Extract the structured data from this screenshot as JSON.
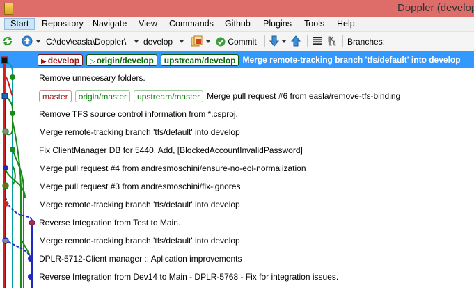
{
  "window": {
    "title": "Doppler (develop"
  },
  "menu": {
    "items": [
      {
        "label": "Start",
        "active": true
      },
      {
        "label": "Repository",
        "active": false
      },
      {
        "label": "Navigate",
        "active": false
      },
      {
        "label": "View",
        "active": false
      },
      {
        "label": "Commands",
        "active": false
      },
      {
        "label": "Github",
        "active": false
      },
      {
        "label": "Plugins",
        "active": false
      },
      {
        "label": "Tools",
        "active": false
      },
      {
        "label": "Help",
        "active": false
      }
    ]
  },
  "toolbar": {
    "repo_path": "C:\\dev\\easla\\Doppler\\",
    "current_branch": "develop",
    "commit_label": "Commit",
    "branches_label": "Branches:"
  },
  "commits": [
    {
      "message": "Merge remote-tracking branch 'tfs/default' into develop",
      "selected": true,
      "refs": [
        {
          "name": "develop",
          "kind": "local",
          "arrow": true
        },
        {
          "name": "origin/develop",
          "kind": "remote",
          "arrow": true
        },
        {
          "name": "upstream/develop",
          "kind": "remote",
          "arrow": false
        }
      ]
    },
    {
      "message": "Remove unnecesary folders.",
      "refs": []
    },
    {
      "message": "Merge pull request #6 from easla/remove-tfs-binding",
      "refs": [
        {
          "name": "master",
          "kind": "local",
          "arrow": false
        },
        {
          "name": "origin/master",
          "kind": "remote",
          "arrow": false
        },
        {
          "name": "upstream/master",
          "kind": "remote",
          "arrow": false
        }
      ]
    },
    {
      "message": "Remove TFS source control information from *.csproj.",
      "refs": []
    },
    {
      "message": "Merge remote-tracking branch 'tfs/default' into develop",
      "refs": []
    },
    {
      "message": "Fix ClientManager DB for 5440. Add, [BlockedAccountInvalidPassword]",
      "refs": []
    },
    {
      "message": "Merge pull request #4 from andresmoschini/ensure-no-eol-normalization",
      "refs": []
    },
    {
      "message": "Merge pull request #3 from andresmoschini/fix-ignores",
      "refs": []
    },
    {
      "message": "Merge remote-tracking branch 'tfs/default' into develop",
      "refs": []
    },
    {
      "message": "Reverse Integration from Test to Main.",
      "refs": []
    },
    {
      "message": "Merge remote-tracking branch 'tfs/default' into develop",
      "refs": []
    },
    {
      "message": "DPLR-5712-Client manager :: Aplication improvements",
      "refs": []
    },
    {
      "message": "Reverse Integration from Dev14 to Main - DPLR-5768 - Fix for integration issues.",
      "refs": []
    }
  ],
  "icons": [
    "app-icon",
    "refresh-icon",
    "navigate-up-icon",
    "commit-stage-icon",
    "commit-check-icon",
    "pull-icon",
    "push-icon",
    "console-icon",
    "settings-icon"
  ],
  "colors": {
    "selection": "#3399ff",
    "titlebar": "#de6d6a",
    "local_branch": "#9e1a1a",
    "remote_branch": "#0a7a0a"
  }
}
